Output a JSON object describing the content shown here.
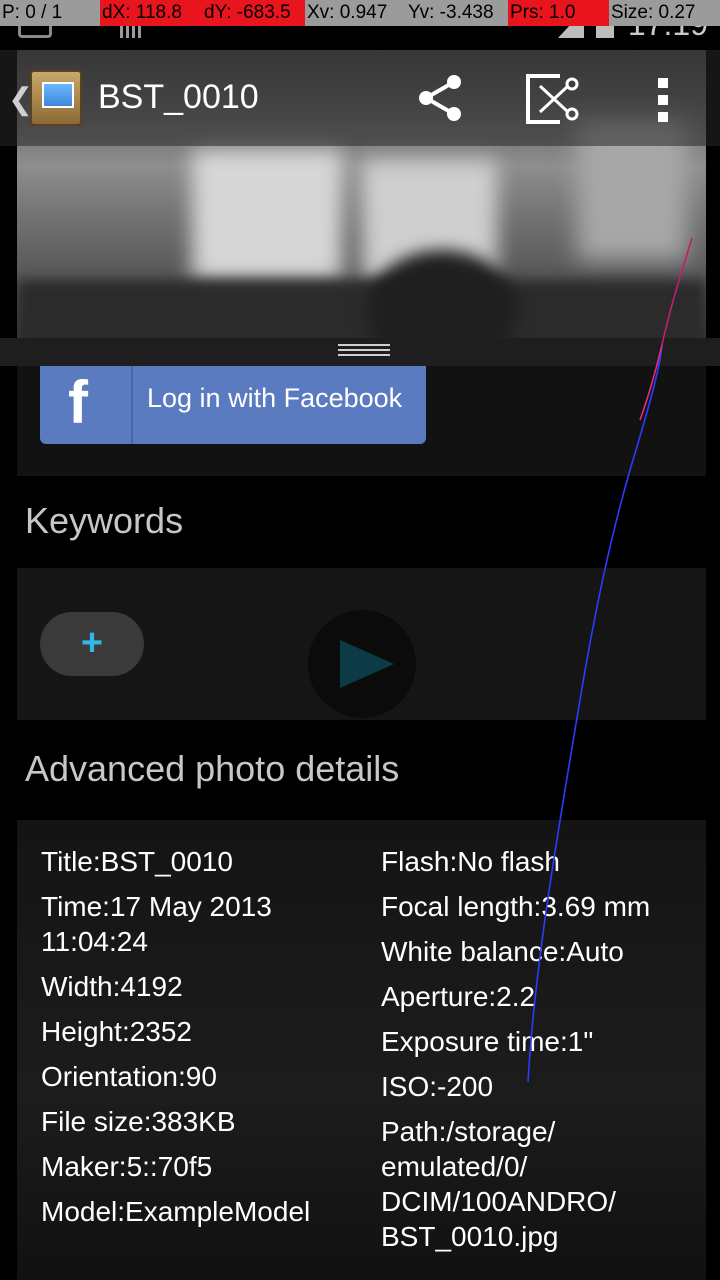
{
  "debug_overlay": {
    "pointer": "P: 0 / 1",
    "dx": "dX: 118.8",
    "dy": "dY: -683.5",
    "xv": "Xv: 0.947",
    "yv": "Yv: -3.438",
    "prs": "Prs: 1.0",
    "size": "Size: 0.27"
  },
  "status_bar": {
    "time": "17:19"
  },
  "action_bar": {
    "title": "BST_0010",
    "icons": [
      "app-icon",
      "share-icon",
      "crop-icon",
      "overflow-menu-icon"
    ]
  },
  "facebook": {
    "login_label": "Log in with Facebook",
    "logo_letter": "f"
  },
  "keywords": {
    "heading": "Keywords",
    "add_label": "+"
  },
  "advanced": {
    "heading": "Advanced photo details",
    "left": [
      "Title:BST_0010",
      "Time:17 May 2013\n11:04:24",
      "Width:4192",
      "Height:2352",
      "Orientation:90",
      "File size:383KB",
      "Maker:5::70f5",
      "Model:ExampleModel"
    ],
    "right": [
      "Flash:No flash",
      "Focal length:3.69 mm",
      "White balance:Auto",
      "Aperture:2.2",
      "Exposure time:1\"",
      "ISO:-200",
      "Path:/storage/\nemulated/0/\nDCIM/100ANDRO/\nBST_0010.jpg"
    ]
  },
  "colors": {
    "facebook_blue": "#5b7bc0",
    "accent_blue": "#33b5e5",
    "debug_red": "#e8141e"
  }
}
